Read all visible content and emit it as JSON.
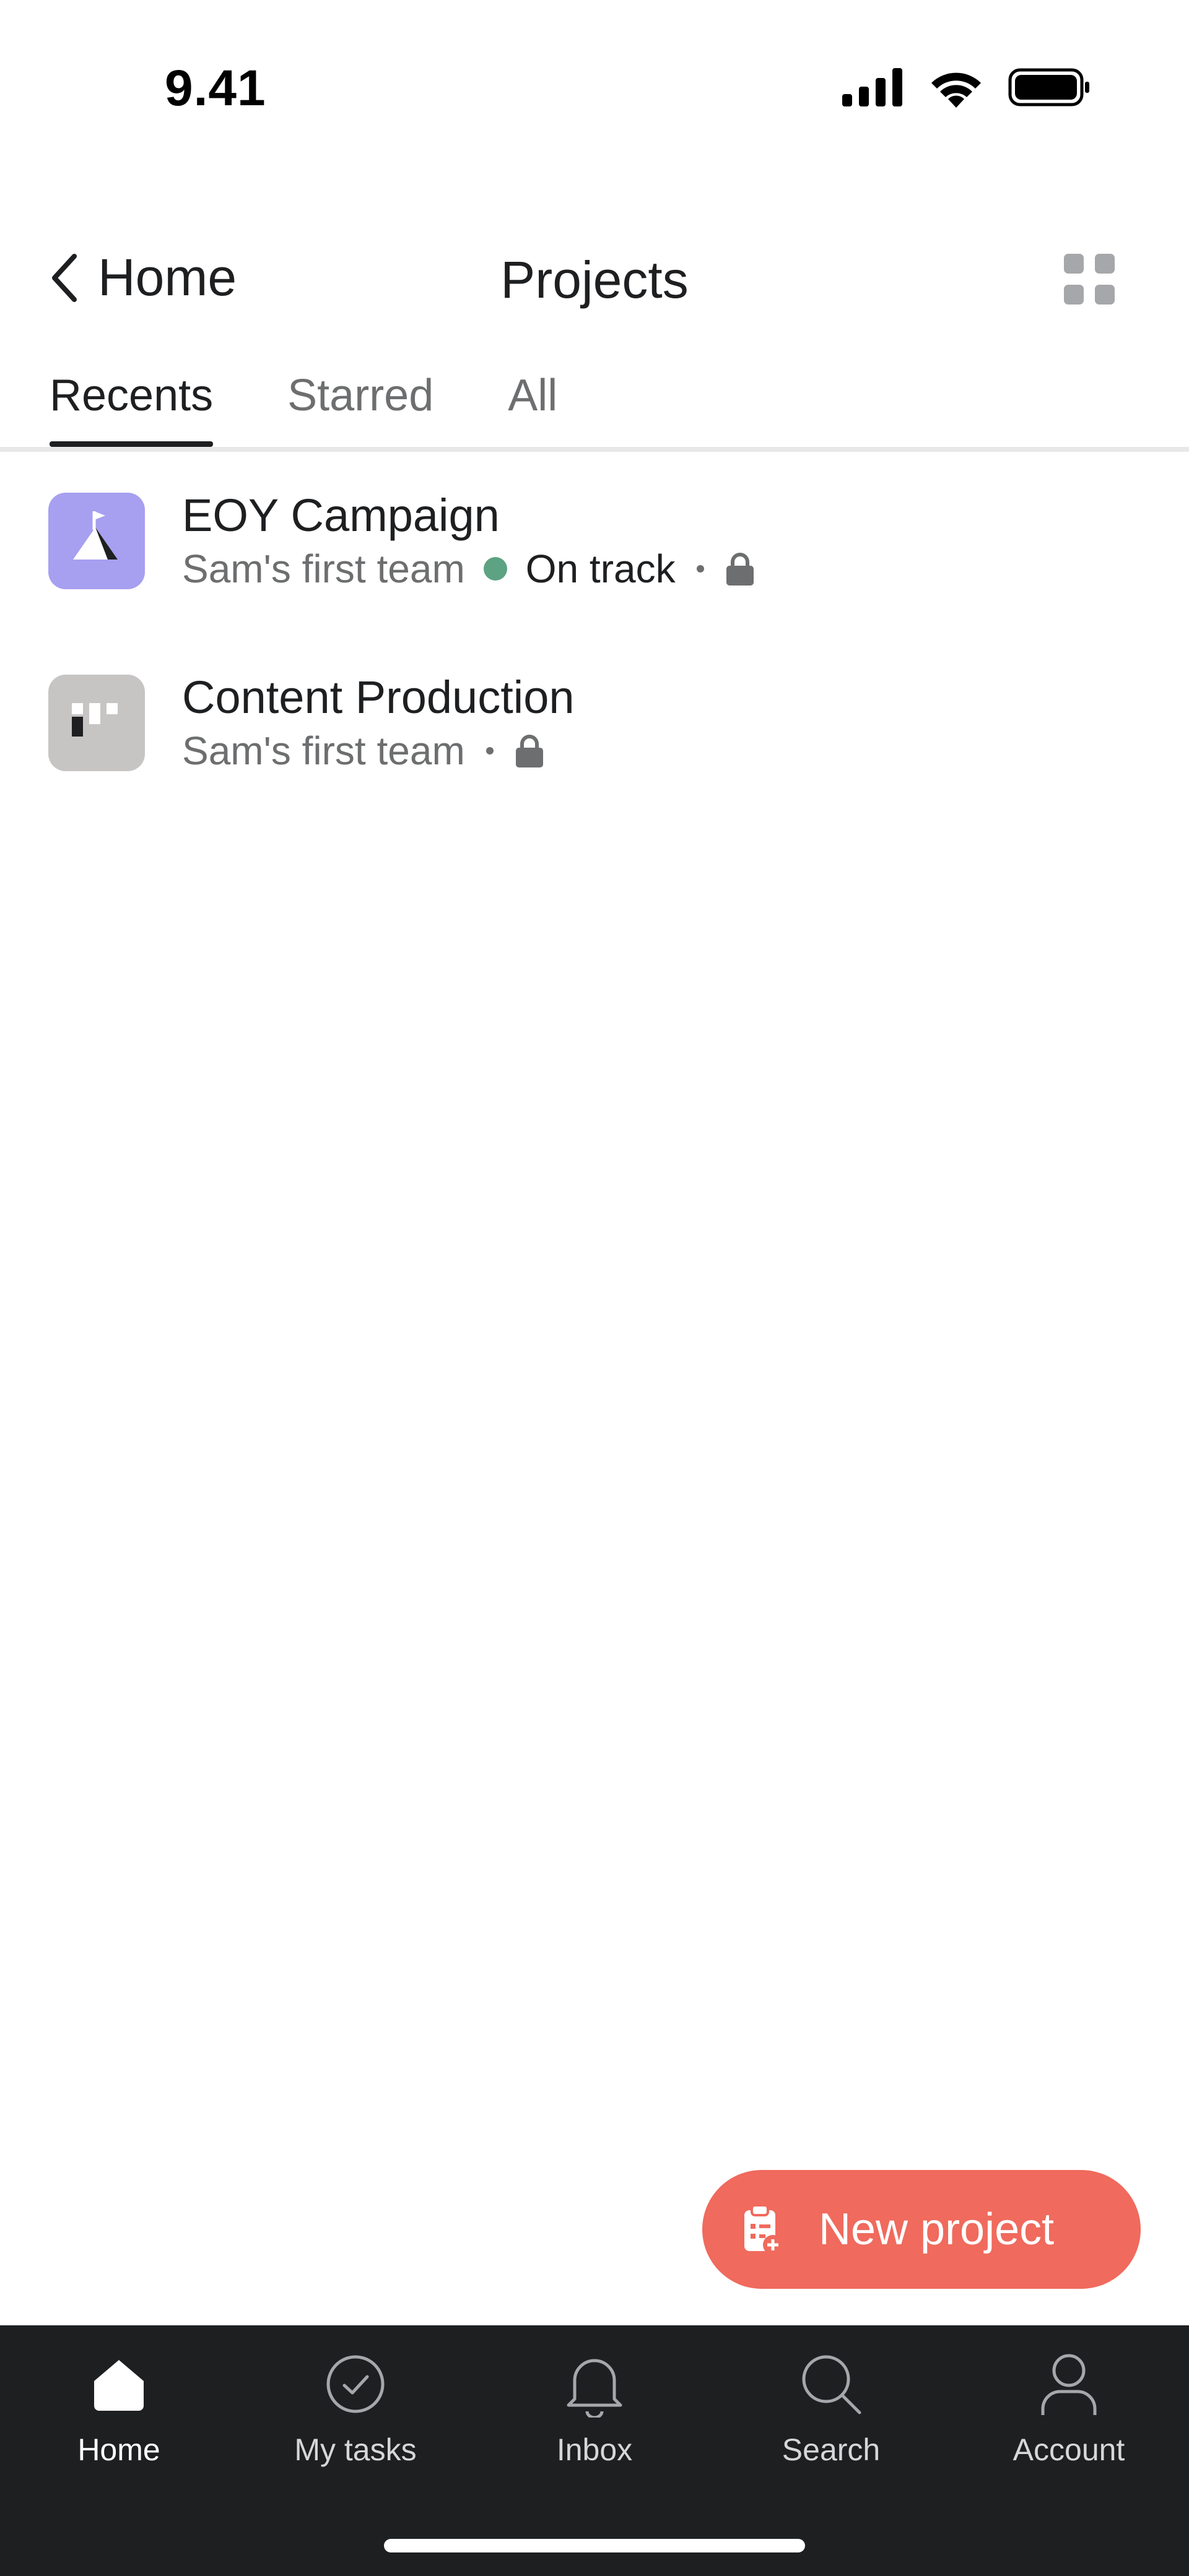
{
  "status_bar": {
    "time": "9.41"
  },
  "header": {
    "back_label": "Home",
    "title": "Projects"
  },
  "tabs": [
    {
      "label": "Recents",
      "active": true
    },
    {
      "label": "Starred",
      "active": false
    },
    {
      "label": "All",
      "active": false
    }
  ],
  "projects": [
    {
      "name": "EOY Campaign",
      "team": "Sam's first team",
      "status": "On track",
      "status_color": "#5da283",
      "icon": "mountain-flag-icon",
      "icon_color": "#a79ff0"
    },
    {
      "name": "Content Production",
      "team": "Sam's first team",
      "icon": "board-icon",
      "icon_color": "#c7c4c4"
    }
  ],
  "fab": {
    "label": "New project",
    "color": "#f06a5d"
  },
  "tabbar": {
    "items": [
      {
        "label": "Home",
        "icon": "home-icon",
        "active": true
      },
      {
        "label": "My tasks",
        "icon": "check-circle-icon",
        "active": false
      },
      {
        "label": "Inbox",
        "icon": "bell-icon",
        "active": false
      },
      {
        "label": "Search",
        "icon": "search-icon",
        "active": false
      },
      {
        "label": "Account",
        "icon": "person-icon",
        "active": false
      }
    ]
  }
}
